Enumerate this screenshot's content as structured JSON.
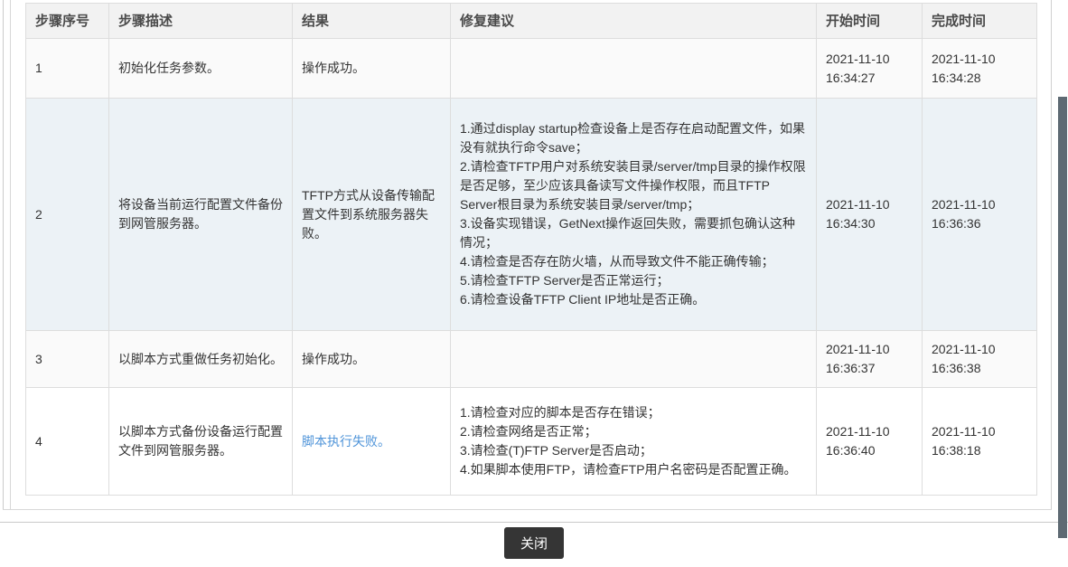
{
  "colors": {
    "link": "#4f94d9",
    "button_bg": "#353535",
    "button_text": "#ffffff",
    "header_bg": "#f2f2f2",
    "border": "#dddddd",
    "row_alt": "#fafafa",
    "row_highlight": "#ecf2f6",
    "scrollbar_thumb": "#5e6a73",
    "text": "#333333"
  },
  "table": {
    "columns": [
      {
        "key": "step",
        "label": "步骤序号"
      },
      {
        "key": "desc",
        "label": "步骤描述"
      },
      {
        "key": "result",
        "label": "结果"
      },
      {
        "key": "advice",
        "label": "修复建议"
      },
      {
        "key": "start",
        "label": "开始时间"
      },
      {
        "key": "end",
        "label": "完成时间"
      }
    ],
    "rows": [
      {
        "step": "1",
        "desc": "初始化任务参数。",
        "result": "操作成功。",
        "result_is_link": false,
        "advice": [],
        "start": "2021-11-10 16:34:27",
        "end": "2021-11-10 16:34:28"
      },
      {
        "step": "2",
        "desc": "将设备当前运行配置文件备份到网管服务器。",
        "result": "TFTP方式从设备传输配置文件到系统服务器失败。",
        "result_is_link": false,
        "advice": [
          "1.通过display startup检查设备上是否存在启动配置文件，如果没有就执行命令save；",
          "2.请检查TFTP用户对系统安装目录/server/tmp目录的操作权限是否足够，至少应该具备读写文件操作权限，而且TFTP Server根目录为系统安装目录/server/tmp；",
          "3.设备实现错误，GetNext操作返回失败，需要抓包确认这种情况；",
          "4.请检查是否存在防火墙，从而导致文件不能正确传输；",
          "5.请检查TFTP Server是否正常运行；",
          "6.请检查设备TFTP Client IP地址是否正确。"
        ],
        "start": "2021-11-10 16:34:30",
        "end": "2021-11-10 16:36:36"
      },
      {
        "step": "3",
        "desc": "以脚本方式重做任务初始化。",
        "result": "操作成功。",
        "result_is_link": false,
        "advice": [],
        "start": "2021-11-10 16:36:37",
        "end": "2021-11-10 16:36:38"
      },
      {
        "step": "4",
        "desc": "以脚本方式备份设备运行配置文件到网管服务器。",
        "result": "脚本执行失败。",
        "result_is_link": true,
        "advice": [
          "1.请检查对应的脚本是否存在错误；",
          "2.请检查网络是否正常；",
          "3.请检查(T)FTP Server是否启动；",
          "4.如果脚本使用FTP，请检查FTP用户名密码是否配置正确。"
        ],
        "start": "2021-11-10 16:36:40",
        "end": "2021-11-10 16:38:18"
      }
    ]
  },
  "footer": {
    "close_label": "关闭"
  }
}
